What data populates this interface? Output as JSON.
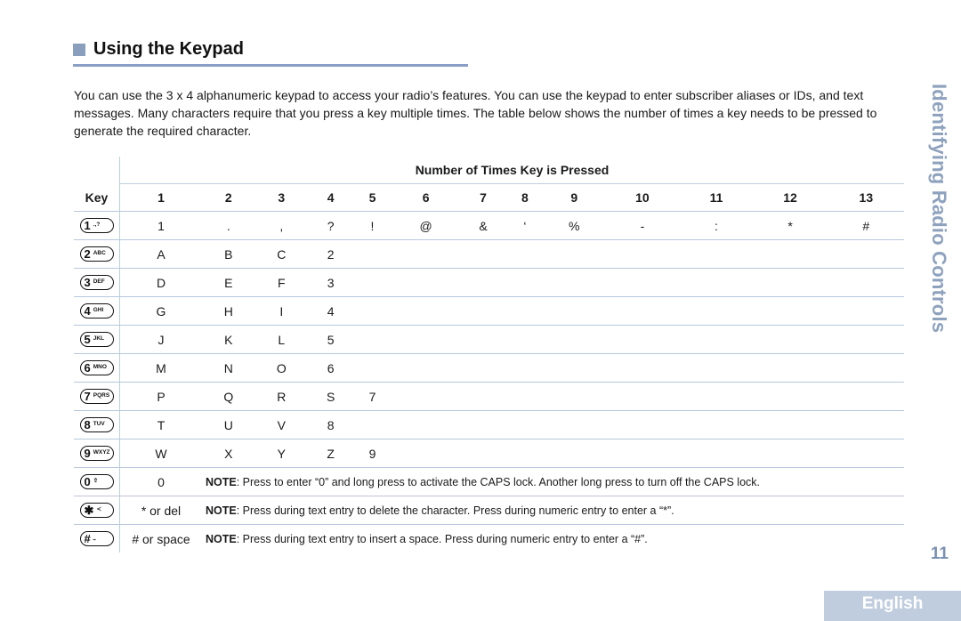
{
  "section": {
    "title": "Using the Keypad",
    "intro": "You can use the 3 x 4 alphanumeric keypad to access your radio’s features. You can use the keypad to enter subscriber aliases or IDs, and text messages. Many characters require that you press a key multiple times. The table below shows the number of times a key needs to be pressed to generate the required character."
  },
  "side_title": "Identifying Radio Controls",
  "page_number": "11",
  "language_tab": "English",
  "table": {
    "group_header": "Number of Times Key is Pressed",
    "key_header": "Key",
    "columns": [
      "1",
      "2",
      "3",
      "4",
      "5",
      "6",
      "7",
      "8",
      "9",
      "10",
      "11",
      "12",
      "13"
    ],
    "rows": [
      {
        "key": {
          "main": "1",
          "sub": ".,?",
          "icon": "key-1-icon"
        },
        "cells": [
          "1",
          ".",
          ",",
          "?",
          "!",
          "@",
          "&",
          "‘",
          "%",
          "-",
          ":",
          "*",
          "#"
        ]
      },
      {
        "key": {
          "main": "2",
          "sub": "ABC",
          "icon": "key-2-icon"
        },
        "cells": [
          "A",
          "B",
          "C",
          "2",
          "",
          "",
          "",
          "",
          "",
          "",
          "",
          "",
          ""
        ]
      },
      {
        "key": {
          "main": "3",
          "sub": "DEF",
          "icon": "key-3-icon"
        },
        "cells": [
          "D",
          "E",
          "F",
          "3",
          "",
          "",
          "",
          "",
          "",
          "",
          "",
          "",
          ""
        ]
      },
      {
        "key": {
          "main": "4",
          "sub": "GHI",
          "icon": "key-4-icon"
        },
        "cells": [
          "G",
          "H",
          "I",
          "4",
          "",
          "",
          "",
          "",
          "",
          "",
          "",
          "",
          ""
        ]
      },
      {
        "key": {
          "main": "5",
          "sub": "JKL",
          "icon": "key-5-icon"
        },
        "cells": [
          "J",
          "K",
          "L",
          "5",
          "",
          "",
          "",
          "",
          "",
          "",
          "",
          "",
          ""
        ]
      },
      {
        "key": {
          "main": "6",
          "sub": "MNO",
          "icon": "key-6-icon"
        },
        "cells": [
          "M",
          "N",
          "O",
          "6",
          "",
          "",
          "",
          "",
          "",
          "",
          "",
          "",
          ""
        ]
      },
      {
        "key": {
          "main": "7",
          "sub": "PQRS",
          "icon": "key-7-icon"
        },
        "cells": [
          "P",
          "Q",
          "R",
          "S",
          "7",
          "",
          "",
          "",
          "",
          "",
          "",
          "",
          ""
        ]
      },
      {
        "key": {
          "main": "8",
          "sub": "TUV",
          "icon": "key-8-icon"
        },
        "cells": [
          "T",
          "U",
          "V",
          "8",
          "",
          "",
          "",
          "",
          "",
          "",
          "",
          "",
          ""
        ]
      },
      {
        "key": {
          "main": "9",
          "sub": "WXYZ",
          "icon": "key-9-icon"
        },
        "cells": [
          "W",
          "X",
          "Y",
          "Z",
          "9",
          "",
          "",
          "",
          "",
          "",
          "",
          "",
          ""
        ]
      }
    ],
    "note_rows": [
      {
        "key": {
          "main": "0",
          "sub": "⇧",
          "icon": "key-0-caps-icon"
        },
        "first": "0",
        "note_label": "NOTE",
        "note": ": Press to enter “0” and long press to activate the CAPS lock. Another long press to turn off the CAPS lock."
      },
      {
        "key": {
          "main": "✱",
          "sub": "≺",
          "icon": "key-star-delete-icon"
        },
        "first": "* or del",
        "note_label": "NOTE",
        "note": ": Press during text entry to delete the character. Press during numeric entry to enter a “*”."
      },
      {
        "key": {
          "main": "#",
          "sub": "⎵",
          "icon": "key-hash-space-icon"
        },
        "first": "# or space",
        "note_label": "NOTE",
        "note": ": Press during text entry to insert a space. Press during numeric entry to enter a “#”."
      }
    ]
  }
}
